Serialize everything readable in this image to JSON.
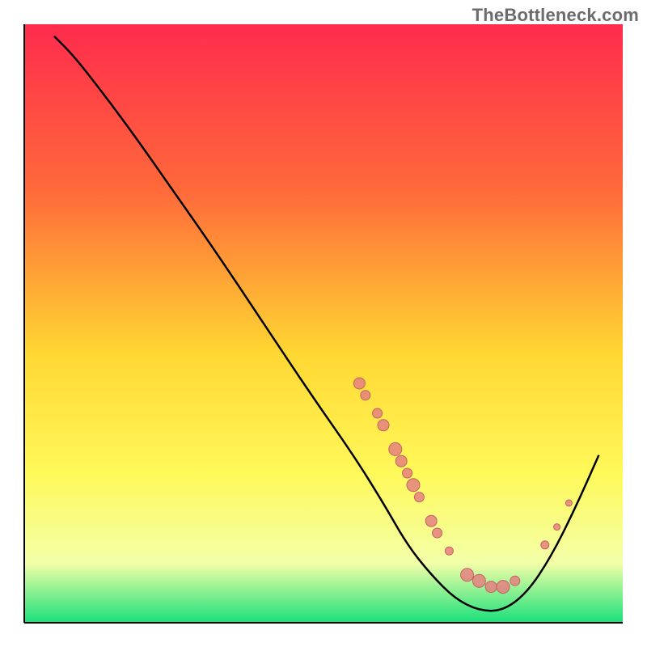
{
  "watermark": "TheBottleneck.com",
  "colors": {
    "gradient_top": "#ff2b4d",
    "gradient_mid1": "#ff6a3a",
    "gradient_mid2": "#ffd732",
    "gradient_mid3": "#fff95a",
    "gradient_mid4": "#f3ffa8",
    "gradient_bottom": "#19e07a",
    "axis": "#000000",
    "curve": "#000000",
    "marker_fill": "#e58080",
    "marker_stroke": "#c46262"
  },
  "chart_data": {
    "type": "line",
    "title": "",
    "xlabel": "",
    "ylabel": "",
    "xlim": [
      0,
      100
    ],
    "ylim": [
      0,
      100
    ],
    "grid": false,
    "legend": false,
    "curve": [
      {
        "x": 5,
        "y": 98
      },
      {
        "x": 8,
        "y": 95
      },
      {
        "x": 12,
        "y": 90
      },
      {
        "x": 18,
        "y": 82
      },
      {
        "x": 25,
        "y": 72
      },
      {
        "x": 32,
        "y": 62
      },
      {
        "x": 40,
        "y": 50
      },
      {
        "x": 48,
        "y": 38
      },
      {
        "x": 55,
        "y": 28
      },
      {
        "x": 60,
        "y": 20
      },
      {
        "x": 64,
        "y": 13
      },
      {
        "x": 68,
        "y": 8
      },
      {
        "x": 72,
        "y": 4
      },
      {
        "x": 76,
        "y": 2
      },
      {
        "x": 80,
        "y": 2
      },
      {
        "x": 84,
        "y": 5
      },
      {
        "x": 88,
        "y": 11
      },
      {
        "x": 92,
        "y": 19
      },
      {
        "x": 96,
        "y": 28
      }
    ],
    "markers": [
      {
        "x": 56,
        "y": 40,
        "r": 7
      },
      {
        "x": 57,
        "y": 38,
        "r": 6
      },
      {
        "x": 59,
        "y": 35,
        "r": 6
      },
      {
        "x": 60,
        "y": 33,
        "r": 7
      },
      {
        "x": 62,
        "y": 29,
        "r": 8
      },
      {
        "x": 63,
        "y": 27,
        "r": 7
      },
      {
        "x": 64,
        "y": 25,
        "r": 6
      },
      {
        "x": 65,
        "y": 23,
        "r": 8
      },
      {
        "x": 66,
        "y": 21,
        "r": 6
      },
      {
        "x": 68,
        "y": 17,
        "r": 7
      },
      {
        "x": 69,
        "y": 15,
        "r": 6
      },
      {
        "x": 71,
        "y": 12,
        "r": 5
      },
      {
        "x": 74,
        "y": 8,
        "r": 8
      },
      {
        "x": 76,
        "y": 7,
        "r": 8
      },
      {
        "x": 78,
        "y": 6,
        "r": 7
      },
      {
        "x": 80,
        "y": 6,
        "r": 8
      },
      {
        "x": 82,
        "y": 7,
        "r": 6
      },
      {
        "x": 87,
        "y": 13,
        "r": 5
      },
      {
        "x": 89,
        "y": 16,
        "r": 4
      },
      {
        "x": 91,
        "y": 20,
        "r": 4
      }
    ]
  }
}
